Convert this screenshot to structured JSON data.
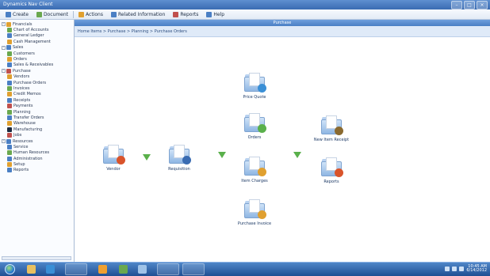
{
  "window": {
    "title": "Dynamics Nav Client",
    "controls": [
      "–",
      "□",
      "×"
    ]
  },
  "toolbar": {
    "buttons": [
      {
        "label": "Create",
        "icon": "create-icon",
        "color": "#4a7fc4"
      },
      {
        "label": "Document",
        "icon": "document-icon",
        "color": "#6aa84f"
      },
      {
        "label": "Actions",
        "icon": "actions-icon",
        "color": "#e0a030"
      },
      {
        "label": "Related Information",
        "icon": "related-icon",
        "color": "#4a7fc4"
      },
      {
        "label": "Reports",
        "icon": "reports-icon",
        "color": "#c0504d"
      },
      {
        "label": "Help",
        "icon": "help-icon",
        "color": "#4a7fc4"
      }
    ]
  },
  "sidebar": {
    "items": [
      {
        "label": "Financials",
        "exp": "-",
        "indent": 0,
        "color": "#e0a030"
      },
      {
        "label": "Chart of Accounts",
        "exp": "",
        "indent": 1,
        "color": "#6aa84f"
      },
      {
        "label": "General Ledger",
        "exp": "",
        "indent": 1,
        "color": "#4a7fc4"
      },
      {
        "label": "Cash Management",
        "exp": "",
        "indent": 1,
        "color": "#e0a030"
      },
      {
        "label": "Sales",
        "exp": "-",
        "indent": 0,
        "color": "#4a7fc4"
      },
      {
        "label": "Customers",
        "exp": "",
        "indent": 1,
        "color": "#6aa84f"
      },
      {
        "label": "Orders",
        "exp": "",
        "indent": 1,
        "color": "#e0a030"
      },
      {
        "label": "Sales & Receivables",
        "exp": "",
        "indent": 1,
        "color": "#4a7fc4"
      },
      {
        "label": "Purchase",
        "exp": "-",
        "indent": 0,
        "color": "#c0504d"
      },
      {
        "label": "Vendors",
        "exp": "",
        "indent": 1,
        "color": "#e0a030"
      },
      {
        "label": "Purchase Orders",
        "exp": "",
        "indent": 1,
        "color": "#4a7fc4"
      },
      {
        "label": "Invoices",
        "exp": "",
        "indent": 1,
        "color": "#6aa84f"
      },
      {
        "label": "Credit Memos",
        "exp": "",
        "indent": 1,
        "color": "#e0a030"
      },
      {
        "label": "Receipts",
        "exp": "",
        "indent": 1,
        "color": "#4a7fc4"
      },
      {
        "label": "Payments",
        "exp": "",
        "indent": 1,
        "color": "#c0504d"
      },
      {
        "label": "Planning",
        "exp": "",
        "indent": 1,
        "color": "#6aa84f"
      },
      {
        "label": "Transfer Orders",
        "exp": "",
        "indent": 1,
        "color": "#4a7fc4"
      },
      {
        "label": "Warehouse",
        "exp": "",
        "indent": 1,
        "color": "#e0a030"
      },
      {
        "label": "Manufacturing",
        "exp": "",
        "indent": 1,
        "color": "#1a2a40"
      },
      {
        "label": "Jobs",
        "exp": "",
        "indent": 1,
        "color": "#c0504d"
      },
      {
        "label": "Resources",
        "exp": "-",
        "indent": 0,
        "color": "#4a7fc4"
      },
      {
        "label": "Service",
        "exp": "",
        "indent": 1,
        "color": "#4a7fc4"
      },
      {
        "label": "Human Resources",
        "exp": "",
        "indent": 1,
        "color": "#6aa84f"
      },
      {
        "label": "Administration",
        "exp": "",
        "indent": 1,
        "color": "#4a7fc4"
      },
      {
        "label": "Setup",
        "exp": "",
        "indent": 1,
        "color": "#e0a030"
      },
      {
        "label": "Reports",
        "exp": "",
        "indent": 1,
        "color": "#4a7fc4"
      }
    ]
  },
  "main": {
    "header_title": "Purchase",
    "path": "Home Items > Purchase > Planning > Purchase Orders",
    "tiles": [
      {
        "caption": "Vendor",
        "badge": "#d9542b"
      },
      {
        "caption": "Requisition",
        "badge": "#3a6cb2"
      },
      {
        "caption": "Price Quote",
        "badge": "#3a8fd6"
      },
      {
        "caption": "Orders",
        "badge": "#5ab04b"
      },
      {
        "caption": "Item Charges",
        "badge": "#e0a030"
      },
      {
        "caption": "Purchase Invoice",
        "badge": "#e0a030"
      },
      {
        "caption": "New Item Receipt",
        "badge": "#8a6a30"
      },
      {
        "caption": "Reports",
        "badge": "#d9542b"
      }
    ]
  },
  "taskbar": {
    "apps": [
      "Explorer",
      "Internet Explorer",
      "Dynamics Nav",
      "Outlook",
      "Word",
      "Excel",
      "Paint",
      "Calculator"
    ],
    "clock_time": "10:45 AM",
    "clock_date": "6/14/2012"
  }
}
